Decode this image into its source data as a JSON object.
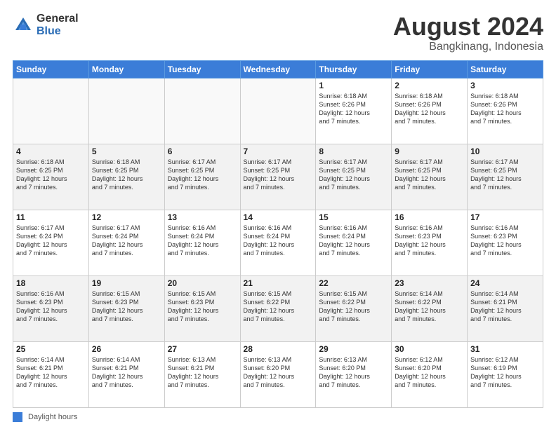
{
  "header": {
    "logo_general": "General",
    "logo_blue": "Blue",
    "title": "August 2024",
    "location": "Bangkinang, Indonesia"
  },
  "days_of_week": [
    "Sunday",
    "Monday",
    "Tuesday",
    "Wednesday",
    "Thursday",
    "Friday",
    "Saturday"
  ],
  "legend": {
    "label": "Daylight hours"
  },
  "weeks": [
    [
      {
        "day": "",
        "detail": "",
        "empty": true
      },
      {
        "day": "",
        "detail": "",
        "empty": true
      },
      {
        "day": "",
        "detail": "",
        "empty": true
      },
      {
        "day": "",
        "detail": "",
        "empty": true
      },
      {
        "day": "1",
        "detail": "Sunrise: 6:18 AM\nSunset: 6:26 PM\nDaylight: 12 hours\nand 7 minutes."
      },
      {
        "day": "2",
        "detail": "Sunrise: 6:18 AM\nSunset: 6:26 PM\nDaylight: 12 hours\nand 7 minutes."
      },
      {
        "day": "3",
        "detail": "Sunrise: 6:18 AM\nSunset: 6:26 PM\nDaylight: 12 hours\nand 7 minutes."
      }
    ],
    [
      {
        "day": "4",
        "detail": "Sunrise: 6:18 AM\nSunset: 6:25 PM\nDaylight: 12 hours\nand 7 minutes."
      },
      {
        "day": "5",
        "detail": "Sunrise: 6:18 AM\nSunset: 6:25 PM\nDaylight: 12 hours\nand 7 minutes."
      },
      {
        "day": "6",
        "detail": "Sunrise: 6:17 AM\nSunset: 6:25 PM\nDaylight: 12 hours\nand 7 minutes."
      },
      {
        "day": "7",
        "detail": "Sunrise: 6:17 AM\nSunset: 6:25 PM\nDaylight: 12 hours\nand 7 minutes."
      },
      {
        "day": "8",
        "detail": "Sunrise: 6:17 AM\nSunset: 6:25 PM\nDaylight: 12 hours\nand 7 minutes."
      },
      {
        "day": "9",
        "detail": "Sunrise: 6:17 AM\nSunset: 6:25 PM\nDaylight: 12 hours\nand 7 minutes."
      },
      {
        "day": "10",
        "detail": "Sunrise: 6:17 AM\nSunset: 6:25 PM\nDaylight: 12 hours\nand 7 minutes."
      }
    ],
    [
      {
        "day": "11",
        "detail": "Sunrise: 6:17 AM\nSunset: 6:24 PM\nDaylight: 12 hours\nand 7 minutes."
      },
      {
        "day": "12",
        "detail": "Sunrise: 6:17 AM\nSunset: 6:24 PM\nDaylight: 12 hours\nand 7 minutes."
      },
      {
        "day": "13",
        "detail": "Sunrise: 6:16 AM\nSunset: 6:24 PM\nDaylight: 12 hours\nand 7 minutes."
      },
      {
        "day": "14",
        "detail": "Sunrise: 6:16 AM\nSunset: 6:24 PM\nDaylight: 12 hours\nand 7 minutes."
      },
      {
        "day": "15",
        "detail": "Sunrise: 6:16 AM\nSunset: 6:24 PM\nDaylight: 12 hours\nand 7 minutes."
      },
      {
        "day": "16",
        "detail": "Sunrise: 6:16 AM\nSunset: 6:23 PM\nDaylight: 12 hours\nand 7 minutes."
      },
      {
        "day": "17",
        "detail": "Sunrise: 6:16 AM\nSunset: 6:23 PM\nDaylight: 12 hours\nand 7 minutes."
      }
    ],
    [
      {
        "day": "18",
        "detail": "Sunrise: 6:16 AM\nSunset: 6:23 PM\nDaylight: 12 hours\nand 7 minutes."
      },
      {
        "day": "19",
        "detail": "Sunrise: 6:15 AM\nSunset: 6:23 PM\nDaylight: 12 hours\nand 7 minutes."
      },
      {
        "day": "20",
        "detail": "Sunrise: 6:15 AM\nSunset: 6:23 PM\nDaylight: 12 hours\nand 7 minutes."
      },
      {
        "day": "21",
        "detail": "Sunrise: 6:15 AM\nSunset: 6:22 PM\nDaylight: 12 hours\nand 7 minutes."
      },
      {
        "day": "22",
        "detail": "Sunrise: 6:15 AM\nSunset: 6:22 PM\nDaylight: 12 hours\nand 7 minutes."
      },
      {
        "day": "23",
        "detail": "Sunrise: 6:14 AM\nSunset: 6:22 PM\nDaylight: 12 hours\nand 7 minutes."
      },
      {
        "day": "24",
        "detail": "Sunrise: 6:14 AM\nSunset: 6:21 PM\nDaylight: 12 hours\nand 7 minutes."
      }
    ],
    [
      {
        "day": "25",
        "detail": "Sunrise: 6:14 AM\nSunset: 6:21 PM\nDaylight: 12 hours\nand 7 minutes."
      },
      {
        "day": "26",
        "detail": "Sunrise: 6:14 AM\nSunset: 6:21 PM\nDaylight: 12 hours\nand 7 minutes."
      },
      {
        "day": "27",
        "detail": "Sunrise: 6:13 AM\nSunset: 6:21 PM\nDaylight: 12 hours\nand 7 minutes."
      },
      {
        "day": "28",
        "detail": "Sunrise: 6:13 AM\nSunset: 6:20 PM\nDaylight: 12 hours\nand 7 minutes."
      },
      {
        "day": "29",
        "detail": "Sunrise: 6:13 AM\nSunset: 6:20 PM\nDaylight: 12 hours\nand 7 minutes."
      },
      {
        "day": "30",
        "detail": "Sunrise: 6:12 AM\nSunset: 6:20 PM\nDaylight: 12 hours\nand 7 minutes."
      },
      {
        "day": "31",
        "detail": "Sunrise: 6:12 AM\nSunset: 6:19 PM\nDaylight: 12 hours\nand 7 minutes."
      }
    ]
  ]
}
